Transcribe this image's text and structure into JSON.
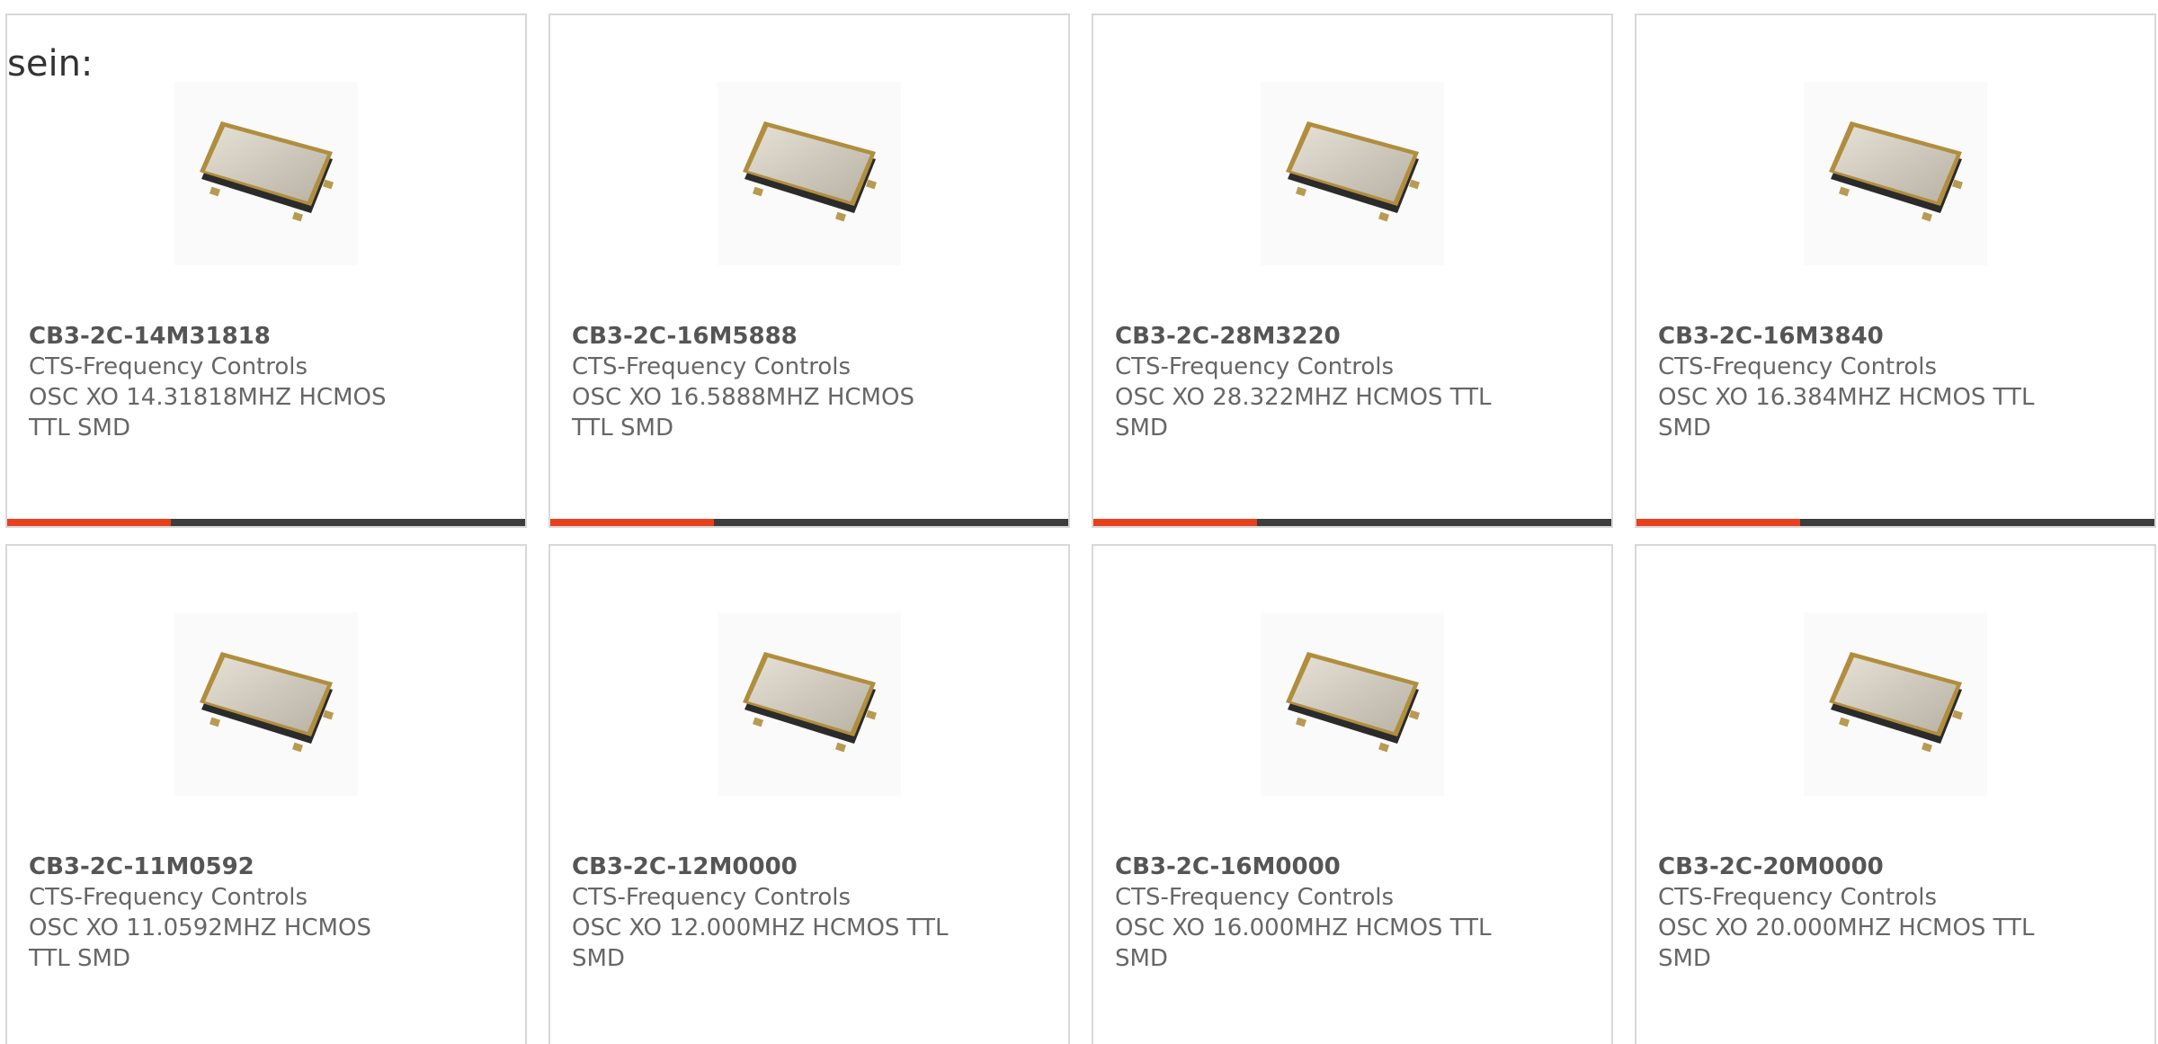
{
  "intro_text": "sein:",
  "products": [
    {
      "part": "CB3-2C-14M31818",
      "manufacturer": "CTS-Frequency Controls",
      "description": "OSC XO 14.31818MHZ HCMOS TTL SMD"
    },
    {
      "part": "CB3-2C-16M5888",
      "manufacturer": "CTS-Frequency Controls",
      "description": "OSC XO 16.5888MHZ HCMOS TTL SMD"
    },
    {
      "part": "CB3-2C-28M3220",
      "manufacturer": "CTS-Frequency Controls",
      "description": "OSC XO 28.322MHZ HCMOS TTL SMD"
    },
    {
      "part": "CB3-2C-16M3840",
      "manufacturer": "CTS-Frequency Controls",
      "description": "OSC XO 16.384MHZ HCMOS TTL SMD"
    },
    {
      "part": "CB3-2C-11M0592",
      "manufacturer": "CTS-Frequency Controls",
      "description": "OSC XO 11.0592MHZ HCMOS TTL SMD"
    },
    {
      "part": "CB3-2C-12M0000",
      "manufacturer": "CTS-Frequency Controls",
      "description": "OSC XO 12.000MHZ HCMOS TTL SMD"
    },
    {
      "part": "CB3-2C-16M0000",
      "manufacturer": "CTS-Frequency Controls",
      "description": "OSC XO 16.000MHZ HCMOS TTL SMD"
    },
    {
      "part": "CB3-2C-20M0000",
      "manufacturer": "CTS-Frequency Controls",
      "description": "OSC XO 20.000MHZ HCMOS TTL SMD"
    }
  ],
  "colors": {
    "accent": "#e8401c",
    "bar": "#3d3d3d",
    "card_border": "#d8d8d8",
    "text": "#666666"
  },
  "icons": {
    "product_image": "smd-crystal-oscillator-icon"
  }
}
